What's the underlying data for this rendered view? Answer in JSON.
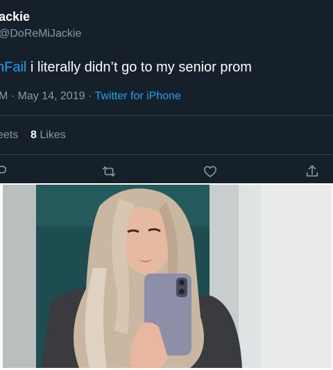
{
  "tweet": {
    "display_name": "ackie",
    "handle": "@DoReMiJackie",
    "hashtag": "nFail",
    "body": " i literally didn’t go to my senior prom",
    "time": "M",
    "date": "May 14, 2019",
    "source": "Twitter for iPhone",
    "retweets_label": "eets",
    "likes_count": "8",
    "likes_label": "Likes"
  },
  "actions": {
    "reply_icon": "reply-icon",
    "retweet_icon": "retweet-icon",
    "like_icon": "heart-icon",
    "share_icon": "share-icon"
  },
  "colors": {
    "background": "#15202b",
    "accent": "#1da1f2",
    "muted": "#8899a6",
    "divider": "#38444d"
  }
}
